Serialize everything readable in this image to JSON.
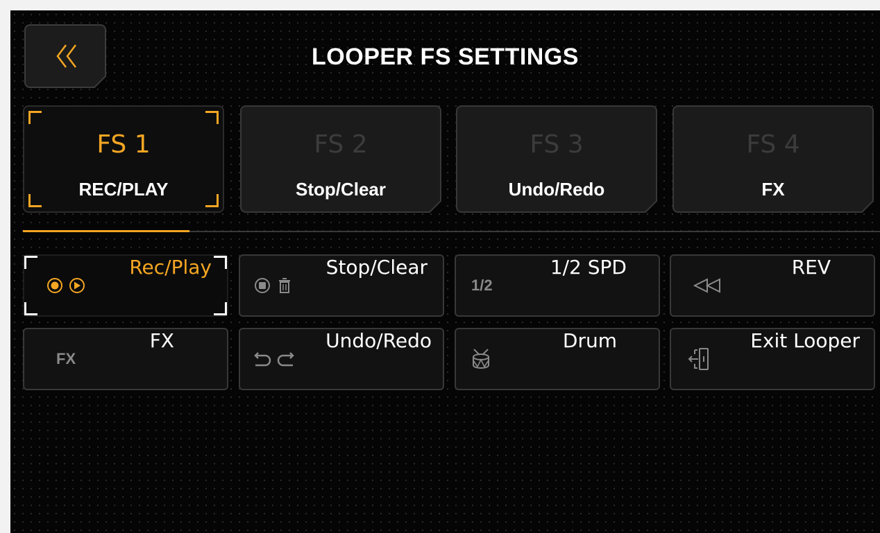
{
  "header": {
    "title": "LOOPER FS SETTINGS",
    "back_icon": "double-chevron-left-icon"
  },
  "footswitches": [
    {
      "number": "FS 1",
      "function": "REC/PLAY",
      "active": true
    },
    {
      "number": "FS 2",
      "function": "Stop/Clear",
      "active": false
    },
    {
      "number": "FS 3",
      "function": "Undo/Redo",
      "active": false
    },
    {
      "number": "FS 4",
      "function": "FX",
      "active": false
    }
  ],
  "functions": [
    {
      "label": "Rec/Play",
      "icon": "record-play-icon",
      "active": true
    },
    {
      "label": "Stop/Clear",
      "icon": "stop-trash-icon",
      "active": false
    },
    {
      "label": "1/2 SPD",
      "icon_text": "1/2",
      "active": false
    },
    {
      "label": "REV",
      "icon": "rewind-icon",
      "active": false
    },
    {
      "label": "FX",
      "icon_text": "FX",
      "active": false
    },
    {
      "label": "Undo/Redo",
      "icon": "undo-redo-icon",
      "active": false
    },
    {
      "label": "Drum",
      "icon": "drum-icon",
      "active": false
    },
    {
      "label": "Exit Looper",
      "icon": "exit-icon",
      "active": false
    }
  ],
  "colors": {
    "accent": "#f5a623",
    "background": "#050505",
    "tile": "#1b1b1b",
    "border": "#383838"
  }
}
